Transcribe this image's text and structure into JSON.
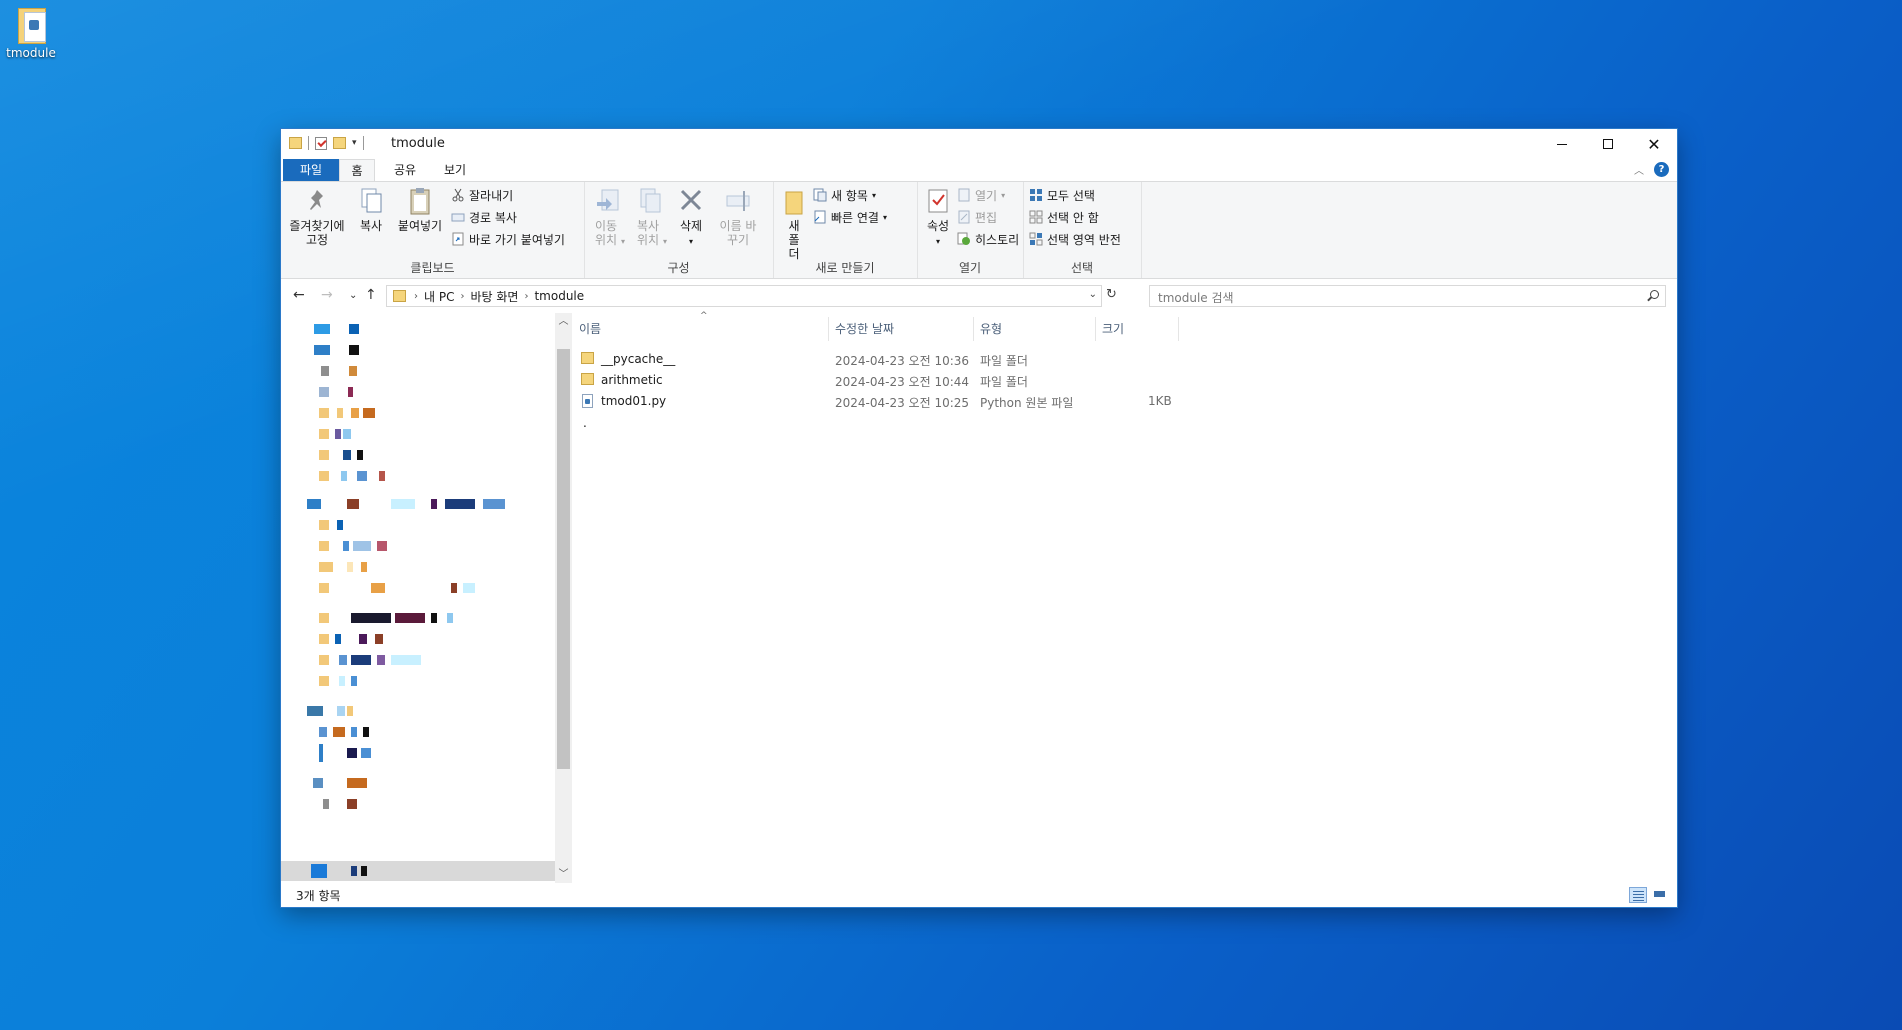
{
  "desktop": {
    "icon_label": "tmodule"
  },
  "window": {
    "title": "tmodule",
    "tabs": [
      "파일",
      "홈",
      "공유",
      "보기"
    ]
  },
  "ribbon": {
    "clipboard": {
      "pin": "즐겨찾기에 고정",
      "copy": "복사",
      "paste": "붙여넣기",
      "cut": "잘라내기",
      "copy_path": "경로 복사",
      "paste_shortcut": "바로 가기 붙여넣기",
      "label": "클립보드"
    },
    "organize": {
      "move_to": "이동 위치",
      "copy_to": "복사 위치",
      "delete": "삭제",
      "rename": "이름 바꾸기",
      "label": "구성"
    },
    "new": {
      "new_folder": "새 폴더",
      "new_item": "새 항목",
      "easy_access": "빠른 연결",
      "label": "새로 만들기"
    },
    "open": {
      "properties": "속성",
      "open": "열기",
      "edit": "편집",
      "history": "히스토리",
      "label": "열기"
    },
    "select": {
      "select_all": "모두 선택",
      "select_none": "선택 안 함",
      "invert": "선택 영역 반전",
      "label": "선택"
    }
  },
  "address": {
    "crumbs": [
      "내 PC",
      "바탕 화면",
      "tmodule"
    ],
    "search_placeholder": "tmodule 검색"
  },
  "columns": {
    "name": "이름",
    "date": "수정한 날짜",
    "type": "유형",
    "size": "크기"
  },
  "files": [
    {
      "name": "__pycache__",
      "date": "2024-04-23 오전 10:36",
      "type": "파일 폴더",
      "size": "",
      "kind": "folder"
    },
    {
      "name": "arithmetic",
      "date": "2024-04-23 오전 10:44",
      "type": "파일 폴더",
      "size": "",
      "kind": "folder"
    },
    {
      "name": "tmod01.py",
      "date": "2024-04-23 오전 10:25",
      "type": "Python 원본 파일",
      "size": "1KB",
      "kind": "python"
    }
  ],
  "status": {
    "count": "3개 항목"
  },
  "colors": {
    "accent": "#1a6bbd",
    "folder": "#f5d57c",
    "desktop": "#0b7fd9"
  }
}
